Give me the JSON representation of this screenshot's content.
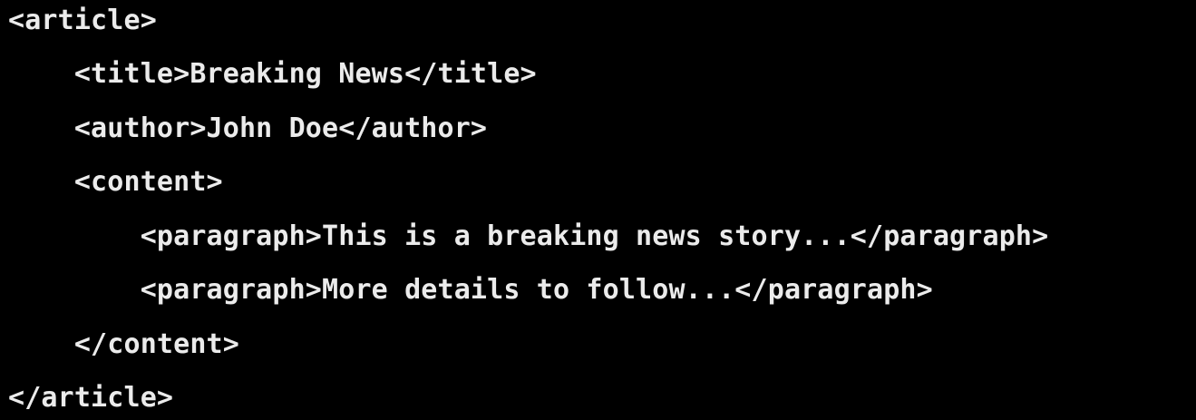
{
  "colors": {
    "background": "#000000",
    "text": "#ebebeb"
  },
  "code": {
    "lines": [
      "<article>",
      "    <title>Breaking News</title>",
      "    <author>John Doe</author>",
      "    <content>",
      "        <paragraph>This is a breaking news story...</paragraph>",
      "        <paragraph>More details to follow...</paragraph>",
      "    </content>",
      "</article>"
    ]
  }
}
